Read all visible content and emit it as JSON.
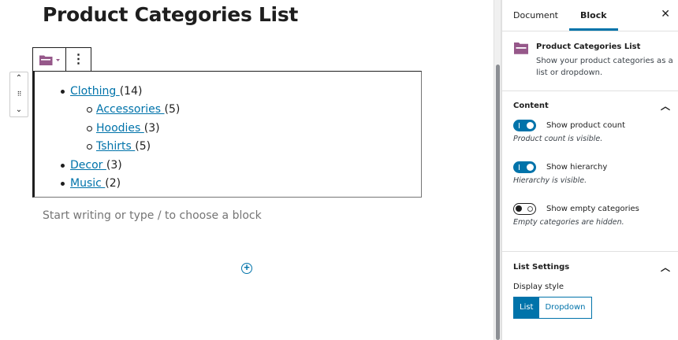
{
  "editor": {
    "title": "Product Categories List",
    "toolbar": {
      "block_icon": "folder-icon",
      "more_icon": "more-vertical-icon"
    },
    "categories": [
      {
        "name": "Clothing ",
        "count": "(14)",
        "children": [
          {
            "name": "Accessories ",
            "count": "(5)"
          },
          {
            "name": "Hoodies ",
            "count": "(3)"
          },
          {
            "name": "Tshirts ",
            "count": "(5)"
          }
        ]
      },
      {
        "name": "Decor ",
        "count": "(3)"
      },
      {
        "name": "Music ",
        "count": "(2)"
      }
    ],
    "placeholder": "Start writing or type / to choose a block"
  },
  "sidebar": {
    "tabs": [
      "Document",
      "Block"
    ],
    "active_tab": "Block",
    "block_card": {
      "title": "Product Categories List",
      "description": "Show your product categories as a list or dropdown."
    },
    "content_panel": {
      "title": "Content",
      "toggles": [
        {
          "label": "Show product count",
          "help": "Product count is visible.",
          "on": true
        },
        {
          "label": "Show hierarchy",
          "help": "Hierarchy is visible.",
          "on": true
        },
        {
          "label": "Show empty categories",
          "help": "Empty categories are hidden.",
          "on": false
        }
      ]
    },
    "list_settings": {
      "title": "List Settings",
      "display_style_label": "Display style",
      "options": [
        "List",
        "Dropdown"
      ],
      "selected": "List"
    }
  },
  "colors": {
    "accent": "#0073aa",
    "block_icon": "#96588a"
  }
}
